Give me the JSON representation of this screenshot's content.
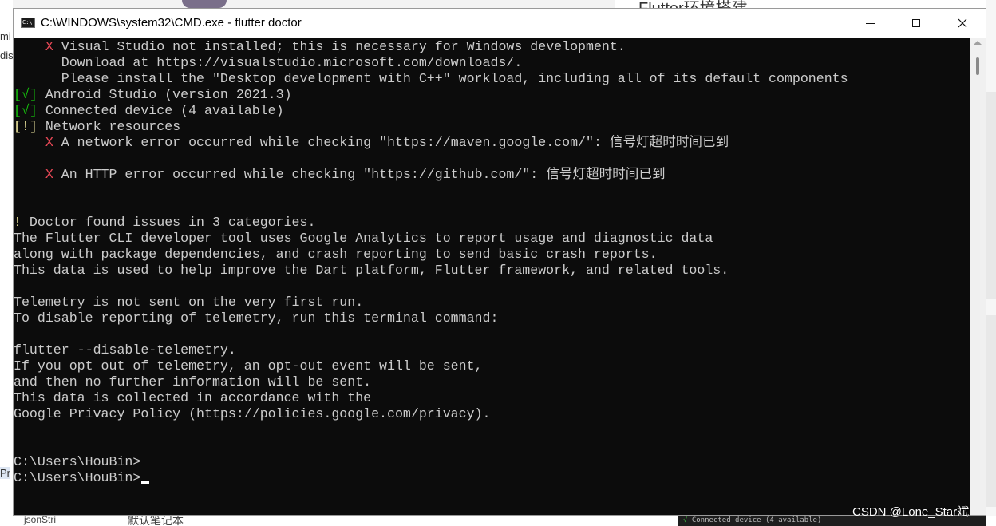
{
  "window": {
    "title": "C:\\WINDOWS\\system32\\CMD.exe - flutter  doctor",
    "icon": "cmd-icon"
  },
  "console_lines": [
    [
      {
        "t": "    "
      },
      {
        "t": "X",
        "c": "red"
      },
      {
        "t": " Visual Studio not installed; this is necessary for Windows development."
      }
    ],
    [
      {
        "t": "      Download at https://visualstudio.microsoft.com/downloads/."
      }
    ],
    [
      {
        "t": "      Please install the \"Desktop development with C++\" workload, including all of its default components"
      }
    ],
    [
      {
        "t": "[√]",
        "c": "green"
      },
      {
        "t": " Android Studio (version 2021.3)"
      }
    ],
    [
      {
        "t": "[√]",
        "c": "green"
      },
      {
        "t": " Connected device (4 available)"
      }
    ],
    [
      {
        "t": "[!]",
        "c": "yellow"
      },
      {
        "t": " Network resources"
      }
    ],
    [
      {
        "t": "    "
      },
      {
        "t": "X",
        "c": "red"
      },
      {
        "t": " A network error occurred while checking \"https://maven.google.com/\": 信号灯超时时间已到"
      }
    ],
    [
      {
        "t": ""
      }
    ],
    [
      {
        "t": "    "
      },
      {
        "t": "X",
        "c": "red"
      },
      {
        "t": " An HTTP error occurred while checking \"https://github.com/\": 信号灯超时时间已到"
      }
    ],
    [
      {
        "t": ""
      }
    ],
    [
      {
        "t": ""
      }
    ],
    [
      {
        "t": "!",
        "c": "yellow"
      },
      {
        "t": " Doctor found issues in 3 categories."
      }
    ],
    [
      {
        "t": "The Flutter CLI developer tool uses Google Analytics to report usage and diagnostic data"
      }
    ],
    [
      {
        "t": "along with package dependencies, and crash reporting to send basic crash reports."
      }
    ],
    [
      {
        "t": "This data is used to help improve the Dart platform, Flutter framework, and related tools."
      }
    ],
    [
      {
        "t": ""
      }
    ],
    [
      {
        "t": "Telemetry is not sent on the very first run."
      }
    ],
    [
      {
        "t": "To disable reporting of telemetry, run this terminal command:"
      }
    ],
    [
      {
        "t": ""
      }
    ],
    [
      {
        "t": "flutter --disable-telemetry."
      }
    ],
    [
      {
        "t": "If you opt out of telemetry, an opt-out event will be sent,"
      }
    ],
    [
      {
        "t": "and then no further information will be sent."
      }
    ],
    [
      {
        "t": "This data is collected in accordance with the"
      }
    ],
    [
      {
        "t": "Google Privacy Policy (https://policies.google.com/privacy)."
      }
    ],
    [
      {
        "t": ""
      }
    ],
    [
      {
        "t": ""
      }
    ],
    [
      {
        "t": "C:\\Users\\HouBin>"
      }
    ],
    [
      {
        "t": "C:\\Users\\HouBin>"
      },
      {
        "cursor": true
      }
    ]
  ],
  "background": {
    "top_title": "Flutter环境搭建",
    "left_fragments": [
      "mi",
      "dis",
      "Pr"
    ],
    "bottom_text": "默认笔记本",
    "bottom_text2": "jsonStri",
    "mini_console": "Connected device (4 available)"
  },
  "watermark": "CSDN @Lone_Star斌",
  "colors": {
    "console_bg": "#0c0c0c",
    "console_fg": "#cccccc",
    "red": "#e74856",
    "green": "#16c60c",
    "yellow": "#f9f1a5"
  }
}
